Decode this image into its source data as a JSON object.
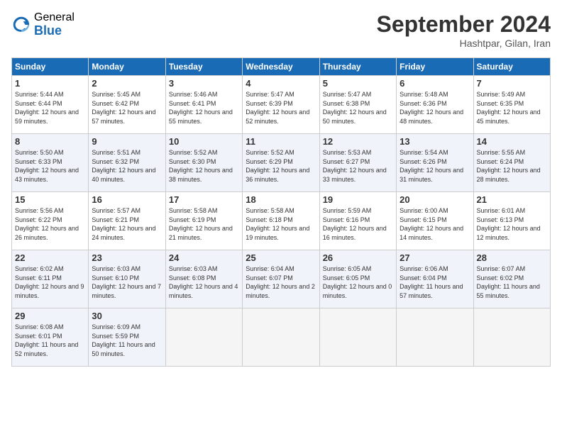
{
  "logo": {
    "general": "General",
    "blue": "Blue"
  },
  "title": "September 2024",
  "location": "Hashtpar, Gilan, Iran",
  "days_header": [
    "Sunday",
    "Monday",
    "Tuesday",
    "Wednesday",
    "Thursday",
    "Friday",
    "Saturday"
  ],
  "weeks": [
    [
      {
        "day": "1",
        "sunrise": "5:44 AM",
        "sunset": "6:44 PM",
        "daylight": "12 hours and 59 minutes."
      },
      {
        "day": "2",
        "sunrise": "5:45 AM",
        "sunset": "6:42 PM",
        "daylight": "12 hours and 57 minutes."
      },
      {
        "day": "3",
        "sunrise": "5:46 AM",
        "sunset": "6:41 PM",
        "daylight": "12 hours and 55 minutes."
      },
      {
        "day": "4",
        "sunrise": "5:47 AM",
        "sunset": "6:39 PM",
        "daylight": "12 hours and 52 minutes."
      },
      {
        "day": "5",
        "sunrise": "5:47 AM",
        "sunset": "6:38 PM",
        "daylight": "12 hours and 50 minutes."
      },
      {
        "day": "6",
        "sunrise": "5:48 AM",
        "sunset": "6:36 PM",
        "daylight": "12 hours and 48 minutes."
      },
      {
        "day": "7",
        "sunrise": "5:49 AM",
        "sunset": "6:35 PM",
        "daylight": "12 hours and 45 minutes."
      }
    ],
    [
      {
        "day": "8",
        "sunrise": "5:50 AM",
        "sunset": "6:33 PM",
        "daylight": "12 hours and 43 minutes."
      },
      {
        "day": "9",
        "sunrise": "5:51 AM",
        "sunset": "6:32 PM",
        "daylight": "12 hours and 40 minutes."
      },
      {
        "day": "10",
        "sunrise": "5:52 AM",
        "sunset": "6:30 PM",
        "daylight": "12 hours and 38 minutes."
      },
      {
        "day": "11",
        "sunrise": "5:52 AM",
        "sunset": "6:29 PM",
        "daylight": "12 hours and 36 minutes."
      },
      {
        "day": "12",
        "sunrise": "5:53 AM",
        "sunset": "6:27 PM",
        "daylight": "12 hours and 33 minutes."
      },
      {
        "day": "13",
        "sunrise": "5:54 AM",
        "sunset": "6:26 PM",
        "daylight": "12 hours and 31 minutes."
      },
      {
        "day": "14",
        "sunrise": "5:55 AM",
        "sunset": "6:24 PM",
        "daylight": "12 hours and 28 minutes."
      }
    ],
    [
      {
        "day": "15",
        "sunrise": "5:56 AM",
        "sunset": "6:22 PM",
        "daylight": "12 hours and 26 minutes."
      },
      {
        "day": "16",
        "sunrise": "5:57 AM",
        "sunset": "6:21 PM",
        "daylight": "12 hours and 24 minutes."
      },
      {
        "day": "17",
        "sunrise": "5:58 AM",
        "sunset": "6:19 PM",
        "daylight": "12 hours and 21 minutes."
      },
      {
        "day": "18",
        "sunrise": "5:58 AM",
        "sunset": "6:18 PM",
        "daylight": "12 hours and 19 minutes."
      },
      {
        "day": "19",
        "sunrise": "5:59 AM",
        "sunset": "6:16 PM",
        "daylight": "12 hours and 16 minutes."
      },
      {
        "day": "20",
        "sunrise": "6:00 AM",
        "sunset": "6:15 PM",
        "daylight": "12 hours and 14 minutes."
      },
      {
        "day": "21",
        "sunrise": "6:01 AM",
        "sunset": "6:13 PM",
        "daylight": "12 hours and 12 minutes."
      }
    ],
    [
      {
        "day": "22",
        "sunrise": "6:02 AM",
        "sunset": "6:11 PM",
        "daylight": "12 hours and 9 minutes."
      },
      {
        "day": "23",
        "sunrise": "6:03 AM",
        "sunset": "6:10 PM",
        "daylight": "12 hours and 7 minutes."
      },
      {
        "day": "24",
        "sunrise": "6:03 AM",
        "sunset": "6:08 PM",
        "daylight": "12 hours and 4 minutes."
      },
      {
        "day": "25",
        "sunrise": "6:04 AM",
        "sunset": "6:07 PM",
        "daylight": "12 hours and 2 minutes."
      },
      {
        "day": "26",
        "sunrise": "6:05 AM",
        "sunset": "6:05 PM",
        "daylight": "12 hours and 0 minutes."
      },
      {
        "day": "27",
        "sunrise": "6:06 AM",
        "sunset": "6:04 PM",
        "daylight": "11 hours and 57 minutes."
      },
      {
        "day": "28",
        "sunrise": "6:07 AM",
        "sunset": "6:02 PM",
        "daylight": "11 hours and 55 minutes."
      }
    ],
    [
      {
        "day": "29",
        "sunrise": "6:08 AM",
        "sunset": "6:01 PM",
        "daylight": "11 hours and 52 minutes."
      },
      {
        "day": "30",
        "sunrise": "6:09 AM",
        "sunset": "5:59 PM",
        "daylight": "11 hours and 50 minutes."
      },
      null,
      null,
      null,
      null,
      null
    ]
  ]
}
